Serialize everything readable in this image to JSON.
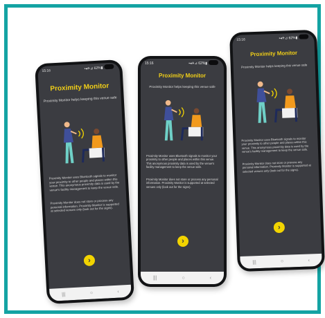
{
  "phones": [
    {
      "status_time": "15:16",
      "status_icons": "▪◂✈⊿ 62%▮",
      "title": "Proximity Monitor",
      "subtitle": "Proximity Monitor helps keeping this venue safe",
      "para1": "Proximity Monitor uses Bluetooth signals to monitor your proximity to other people and places within this venue. This anonymous proximity data is used by the venue's facility management to keep the venue safe.",
      "para2": "Proximity Monitor does not store or process any personal information. Proximity Monitor is supported at selected venues only (look out for the signs).",
      "next_label": "›",
      "nav": [
        "|||",
        "○",
        "‹"
      ]
    },
    {
      "status_time": "15:16",
      "status_icons": "▪◂✈⊿ 62%▮",
      "title": "Proximity Monitor",
      "subtitle": "Proximity Monitor helps keeping this venue safe",
      "para1": "Proximity Monitor uses Bluetooth signals to monitor your proximity to other people and places within this venue. This anonymous proximity data is used by the venue's facility management to keep the venue safe.",
      "para2": "Proximity Monitor does not store or process any personal information. Proximity Monitor is supported at selected venues only (look out for the signs).",
      "next_label": "›",
      "nav": [
        "|||",
        "○",
        "‹"
      ]
    },
    {
      "status_time": "15:16",
      "status_icons": "▪◂✈⊿ 62%▮",
      "title": "Proximity Monitor",
      "subtitle": "Proximity Monitor helps keeping this venue safe",
      "para1": "Proximity Monitor uses Bluetooth signals to monitor your proximity to other people and places within this venue. This anonymous proximity data is used by the venue's facility management to keep the venue safe.",
      "para2": "Proximity Monitor does not store or process any personal information. Proximity Monitor is supported at selected venues only (look out for the signs).",
      "next_label": "›",
      "nav": [
        "|||",
        "○",
        "‹"
      ]
    }
  ],
  "colors": {
    "frame": "#14a3a3",
    "accent": "#f2d400",
    "screen": "#3b3c41"
  }
}
